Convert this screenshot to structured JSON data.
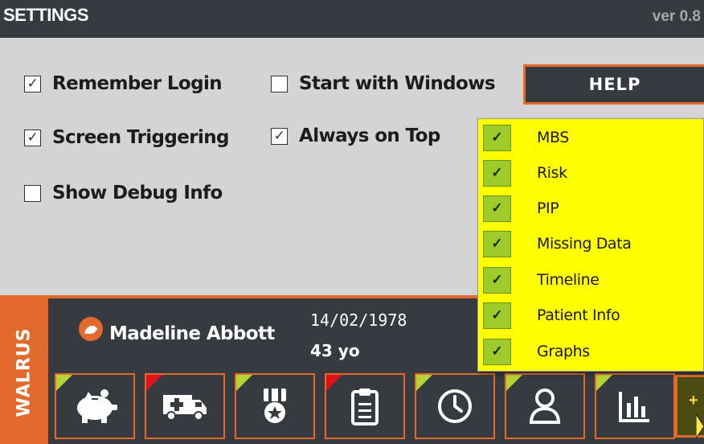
{
  "titlebar": {
    "title": "SETTINGS",
    "version": "ver 0.8"
  },
  "settings": {
    "remember_login": {
      "label": "Remember Login",
      "checked": true
    },
    "start_with_windows": {
      "label": "Start with Windows",
      "checked": false
    },
    "screen_triggering": {
      "label": "Screen Triggering",
      "checked": true
    },
    "always_on_top": {
      "label": "Always on Top",
      "checked": true
    },
    "show_debug_info": {
      "label": "Show Debug Info",
      "checked": false
    },
    "help_label": "HELP"
  },
  "dropdown": {
    "items": [
      {
        "label": "MBS",
        "checked": true
      },
      {
        "label": "Risk",
        "checked": true
      },
      {
        "label": "PIP",
        "checked": true
      },
      {
        "label": "Missing Data",
        "checked": true
      },
      {
        "label": "Timeline",
        "checked": true
      },
      {
        "label": "Patient Info",
        "checked": true
      },
      {
        "label": "Graphs",
        "checked": true
      }
    ]
  },
  "brand": {
    "name": "WALRUS"
  },
  "patient": {
    "name": "Madeline Abbott",
    "dob": "14/02/1978",
    "age": "43 yo"
  },
  "tiles": [
    {
      "icon": "piggy-bank-icon",
      "flag": "#b5d334"
    },
    {
      "icon": "ambulance-icon",
      "flag": "#e0121c"
    },
    {
      "icon": "medal-icon",
      "flag": "#b5d334"
    },
    {
      "icon": "clipboard-icon",
      "flag": "#e0121c"
    },
    {
      "icon": "clock-icon",
      "flag": "#b5d334"
    },
    {
      "icon": "person-icon",
      "flag": "#b5d334"
    },
    {
      "icon": "bar-chart-icon",
      "flag": "#b5d334"
    }
  ],
  "add_button": {
    "label": "+"
  },
  "colors": {
    "accent": "#e26a2c",
    "dark": "#373a3f",
    "panel": "#d4d4d4",
    "dropdown_bg": "#ffff00",
    "check_bg": "#9dcc2a"
  }
}
